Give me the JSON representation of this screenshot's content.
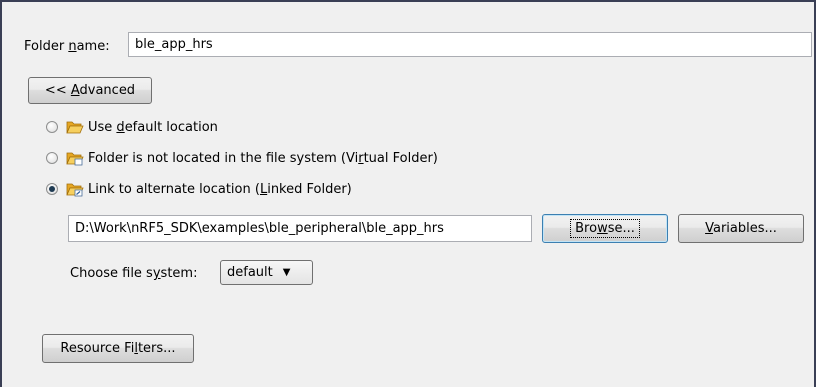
{
  "folder_name": {
    "label_prefix": "Folder ",
    "label_mnemonic": "n",
    "label_suffix": "ame:",
    "value": "ble_app_hrs"
  },
  "advanced_button": {
    "prefix": "<< ",
    "mnemonic": "A",
    "suffix": "dvanced"
  },
  "location_options": [
    {
      "prefix": "Use ",
      "mnemonic": "d",
      "suffix": "efault location",
      "selected": false
    },
    {
      "prefix": "Folder is not located in the file system (Vi",
      "mnemonic": "r",
      "suffix": "tual Folder)",
      "selected": false
    },
    {
      "prefix": "Link to alternate location (",
      "mnemonic": "L",
      "suffix": "inked Folder)",
      "selected": true
    }
  ],
  "linked_path": {
    "value": "D:\\Work\\nRF5_SDK\\examples\\ble_peripheral\\ble_app_hrs"
  },
  "browse_button": {
    "prefix": "Bro",
    "mnemonic": "w",
    "suffix": "se..."
  },
  "variables_button": {
    "prefix": "",
    "mnemonic": "V",
    "suffix": "ariables..."
  },
  "file_system": {
    "label_prefix": "Choose file s",
    "label_mnemonic": "y",
    "label_suffix": "stem:",
    "selected": "default"
  },
  "resource_filters_button": {
    "prefix": "Resource Fi",
    "mnemonic": "l",
    "suffix": "ters..."
  },
  "colors": {
    "dialog_bg": "#f0f0f0",
    "frame_border": "#3a3f55",
    "folder_yellow": "#f3c443"
  }
}
